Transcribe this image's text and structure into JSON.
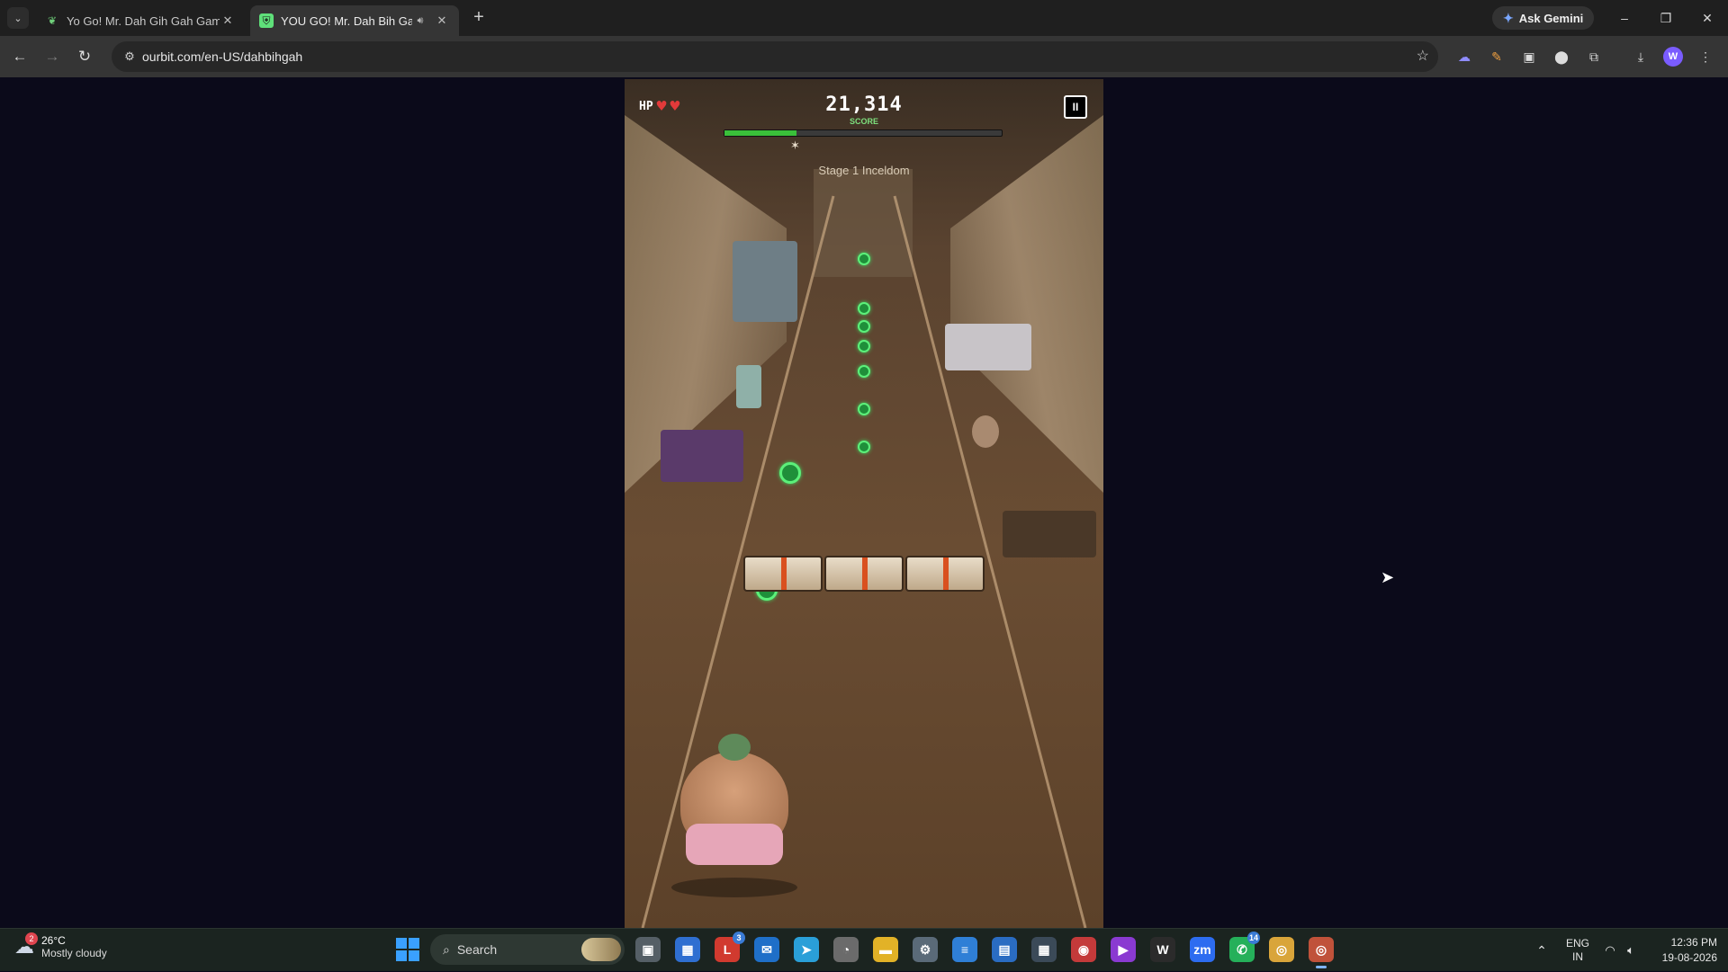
{
  "browser": {
    "tabs": [
      {
        "title": "Yo Go! Mr. Dah Gih Gah Game (",
        "favicon": "leaf-icon",
        "active": false
      },
      {
        "title": "YOU GO! Mr. Dah Bih Gah",
        "favicon": "shield-icon",
        "active": true,
        "audio": "speaker-icon"
      }
    ],
    "new_tab": "+",
    "gemini_label": "Ask Gemini",
    "window_controls": {
      "minimize": "–",
      "restore": "❐",
      "close": "✕"
    },
    "url": "ourbit.com/en-US/dahbihgah",
    "profile_initial": "W"
  },
  "game": {
    "hp_label": "HP",
    "hp_hearts": 2,
    "score": "21,314",
    "score_label": "SCORE",
    "progress": 0.26,
    "stage": "Stage 1 Inceldom",
    "pause_label": "II"
  },
  "taskbar": {
    "weather_temp": "26°C",
    "weather_condition": "Mostly cloudy",
    "weather_badge": "2",
    "search_label": "Search",
    "apps": [
      {
        "name": "task-view-icon",
        "glyph": "▣",
        "color": "#555f66"
      },
      {
        "name": "store-icon",
        "glyph": "▦",
        "color": "#2f6fd1"
      },
      {
        "name": "app-l-icon",
        "glyph": "L",
        "color": "#d13a2f",
        "badge": "3"
      },
      {
        "name": "mail-icon",
        "glyph": "✉",
        "color": "#1f6fc8"
      },
      {
        "name": "telegram-icon",
        "glyph": "➤",
        "color": "#2a9fd8"
      },
      {
        "name": "clock-app-icon",
        "glyph": "◔",
        "color": "#6b6b6b"
      },
      {
        "name": "file-explorer-icon",
        "glyph": "▬",
        "color": "#e2b227"
      },
      {
        "name": "settings-icon",
        "glyph": "⚙",
        "color": "#5a6a78"
      },
      {
        "name": "notepad-icon",
        "glyph": "≡",
        "color": "#2f7fd6"
      },
      {
        "name": "calendar-icon",
        "glyph": "▤",
        "color": "#2a6cc2"
      },
      {
        "name": "calculator-icon",
        "glyph": "▦",
        "color": "#3b4a58"
      },
      {
        "name": "chrome-dev-icon",
        "glyph": "◉",
        "color": "#c43a3a"
      },
      {
        "name": "clapper-icon",
        "glyph": "▶",
        "color": "#8a3ad1"
      },
      {
        "name": "word-w-icon",
        "glyph": "W",
        "color": "#2b2b2b"
      },
      {
        "name": "zoom-icon",
        "glyph": "zm",
        "color": "#2d6cf0"
      },
      {
        "name": "whatsapp-icon",
        "glyph": "✆",
        "color": "#25b05a",
        "badge": "14"
      },
      {
        "name": "chrome-icon",
        "glyph": "◎",
        "color": "#d9a53a"
      },
      {
        "name": "chrome-active-icon",
        "glyph": "◎",
        "color": "#c0523a",
        "active": true
      }
    ],
    "lang_line1": "ENG",
    "lang_line2": "IN",
    "time": "12:36 PM",
    "date": "19-08-2026"
  }
}
